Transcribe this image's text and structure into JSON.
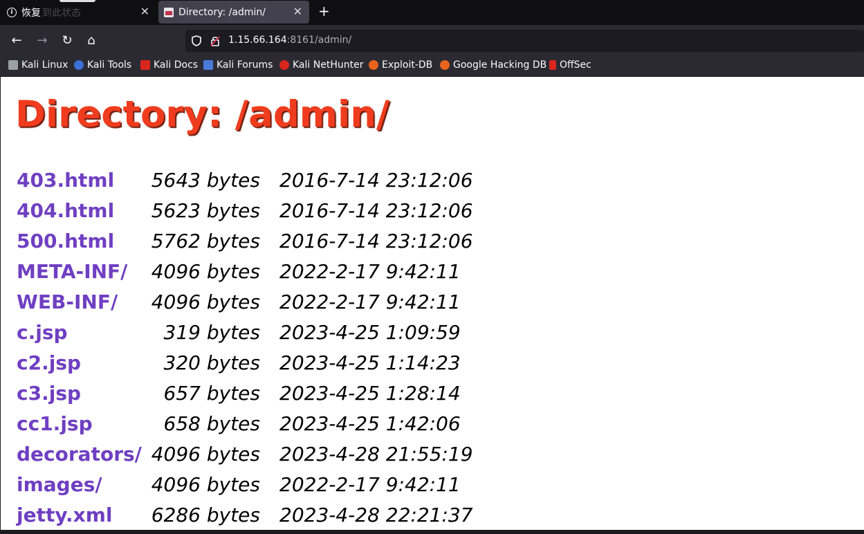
{
  "browser": {
    "tabs": [
      {
        "label": "恢复",
        "ghost_label": "到此状态"
      },
      {
        "label": "Directory: /admin/"
      }
    ],
    "url": {
      "host": "1.15.66.164",
      "path": ":8161/admin/"
    },
    "bookmarks": [
      {
        "label": "Kali Linux",
        "icon": "kali-dragon-icon",
        "color": "#9aa0a6"
      },
      {
        "label": "Kali Tools",
        "icon": "kali-tools-icon",
        "color": "#3d6fd6"
      },
      {
        "label": "Kali Docs",
        "icon": "kali-docs-icon",
        "color": "#d9261c"
      },
      {
        "label": "Kali Forums",
        "icon": "kali-forums-icon",
        "color": "#4a7bd8"
      },
      {
        "label": "Kali NetHunter",
        "icon": "nethunter-icon",
        "color": "#d9261c"
      },
      {
        "label": "Exploit-DB",
        "icon": "exploit-db-icon",
        "color": "#e8631c"
      },
      {
        "label": "Google Hacking DB",
        "icon": "ghdb-icon",
        "color": "#e8631c"
      },
      {
        "label": "OffSec",
        "icon": "offsec-icon",
        "color": "#d9261c"
      }
    ]
  },
  "page": {
    "title": "Directory: /admin/",
    "files": [
      {
        "name": "403.html",
        "size": "5643 bytes",
        "date": "2016-7-14 23:12:06"
      },
      {
        "name": "404.html",
        "size": "5623 bytes",
        "date": "2016-7-14 23:12:06"
      },
      {
        "name": "500.html",
        "size": "5762 bytes",
        "date": "2016-7-14 23:12:06"
      },
      {
        "name": "META-INF/",
        "size": "4096 bytes",
        "date": "2022-2-17 9:42:11"
      },
      {
        "name": "WEB-INF/",
        "size": "4096 bytes",
        "date": "2022-2-17 9:42:11"
      },
      {
        "name": "c.jsp",
        "size": "319 bytes",
        "date": "2023-4-25 1:09:59"
      },
      {
        "name": "c2.jsp",
        "size": "320 bytes",
        "date": "2023-4-25 1:14:23"
      },
      {
        "name": "c3.jsp",
        "size": "657 bytes",
        "date": "2023-4-25 1:28:14"
      },
      {
        "name": "cc1.jsp",
        "size": "658 bytes",
        "date": "2023-4-25 1:42:06"
      },
      {
        "name": "decorators/",
        "size": "4096 bytes",
        "date": "2023-4-28 21:55:19"
      },
      {
        "name": "images/",
        "size": "4096 bytes",
        "date": "2022-2-17 9:42:11"
      },
      {
        "name": "jetty.xml",
        "size": "6286 bytes",
        "date": "2023-4-28 22:21:37"
      }
    ]
  }
}
